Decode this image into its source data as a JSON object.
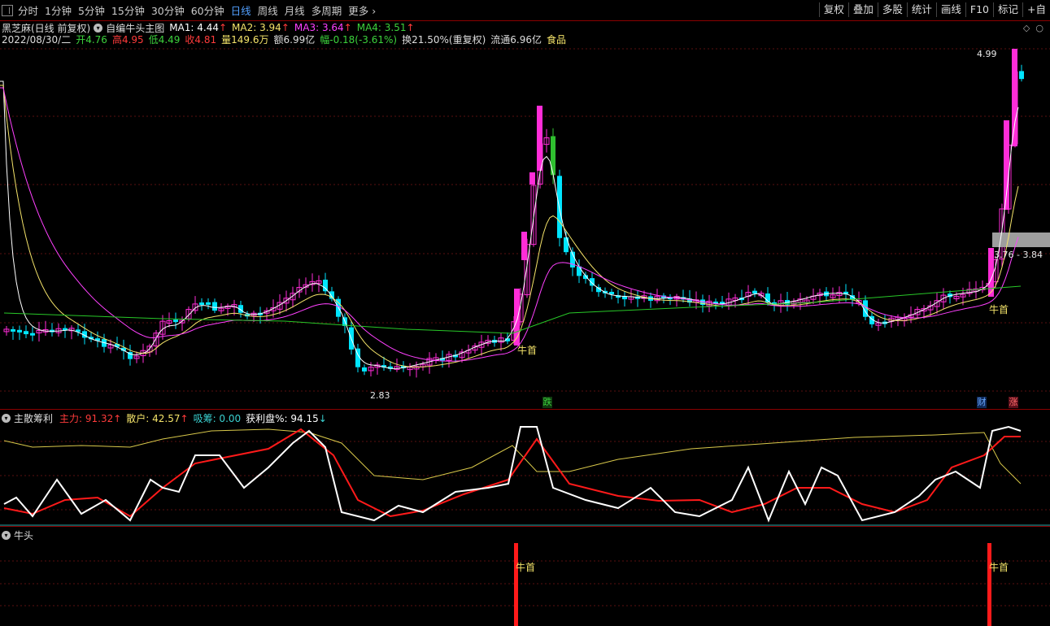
{
  "toolbar": {
    "tabs": [
      "分时",
      "1分钟",
      "5分钟",
      "15分钟",
      "30分钟",
      "60分钟",
      "日线",
      "周线",
      "月线",
      "多周期",
      "更多"
    ],
    "active_tab": "日线",
    "right_buttons": [
      "复权",
      "叠加",
      "多股",
      "统计",
      "画线",
      "F10",
      "标记",
      "+自"
    ]
  },
  "stock": {
    "name": "黑芝麻(日线 前复权)",
    "indicator_name": "自编牛头主图",
    "ma1": "MA1: 4.44",
    "ma2": "MA2: 3.94",
    "ma3": "MA3: 3.64",
    "ma4": "MA4: 3.51",
    "date": "2022/08/30/二",
    "open": "开4.76",
    "high": "高4.95",
    "low": "低4.49",
    "close": "收4.81",
    "volume": "量149.6万",
    "amount": "额6.99亿",
    "change": "幅-0.18(-3.61%)",
    "turnover": "换21.50%(重复权)",
    "float_cap": "流通6.96亿",
    "sector": "食品"
  },
  "main_chart": {
    "high_label": "4.99",
    "low_label": "2.83",
    "range_label": "3.76 - 3.84",
    "signal_label": "牛首",
    "event_labels": {
      "fall": "跌",
      "finance": "财",
      "rise": "涨"
    },
    "colors": {
      "up": "#ff2dd8",
      "down": "#00e5ff",
      "ma1": "#ffffff",
      "ma2": "#f5e46a",
      "ma3": "#ff40ff",
      "ma4": "#28c828",
      "green_candle": "#2fbf2f"
    }
  },
  "sub1": {
    "title": "主散筹利",
    "main_force": "主力: 91.32",
    "retail": "散户: 42.57",
    "absorb": "吸筹: 0.00",
    "profit": "获利盘%: 94.15"
  },
  "sub2": {
    "title": "牛头",
    "signal_label": "牛首"
  }
}
